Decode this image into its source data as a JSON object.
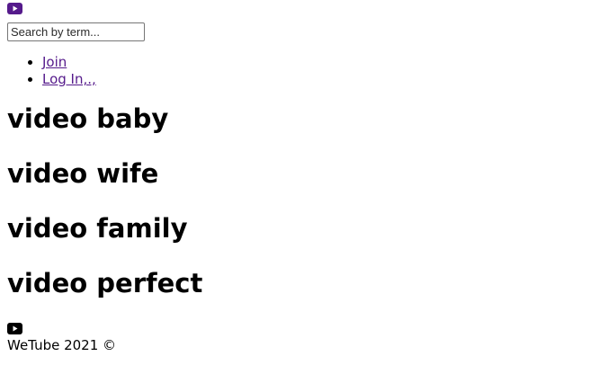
{
  "header": {
    "logo_icon": "youtube-icon",
    "logo_color": "#551a8b"
  },
  "search": {
    "placeholder": "Search by term..."
  },
  "nav": {
    "join_label": "Join",
    "login_label": "Log In,.,"
  },
  "videos": [
    {
      "title": "video baby"
    },
    {
      "title": "video wife"
    },
    {
      "title": "video family"
    },
    {
      "title": "video perfect"
    }
  ],
  "footer": {
    "logo_icon": "youtube-icon",
    "copyright": "WeTube 2021 ©"
  }
}
